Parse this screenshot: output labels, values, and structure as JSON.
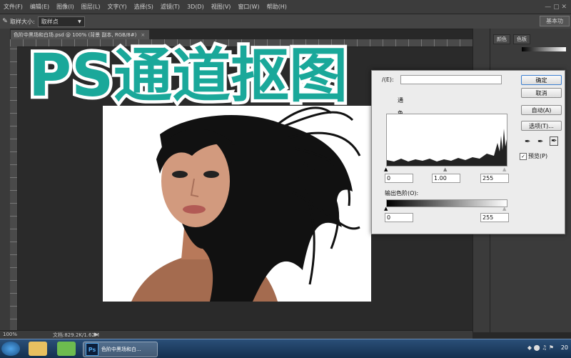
{
  "menu": [
    "文件(F)",
    "编辑(E)",
    "图像(I)",
    "图层(L)",
    "文字(Y)",
    "选择(S)",
    "滤镜(T)",
    "3D(D)",
    "视图(V)",
    "窗口(W)",
    "帮助(H)"
  ],
  "options": {
    "sample_size_label": "取样大小:",
    "sample_size_value": "取样点",
    "workspace": "基本功"
  },
  "document_tab": {
    "title": "色阶中黑场和白场.psd @ 100% (背景 副本, RGB/8#)",
    "close": "×"
  },
  "overlay_title": "PS通道抠图",
  "right_panel": {
    "tab1": "颜色",
    "tab2": "色板"
  },
  "levels_dialog": {
    "channel_label": "/(E):",
    "partial_label_1": "通",
    "partial_label_2": "色",
    "input_black": "0",
    "input_gamma": "1.00",
    "input_white": "255",
    "output_label": "输出色阶(O):",
    "output_black": "0",
    "output_white": "255",
    "buttons": {
      "ok": "确定",
      "cancel": "取消",
      "auto": "自动(A)",
      "options": "选项(T)..."
    },
    "preview_label": "预览(P)",
    "preview_checked": true
  },
  "status": {
    "zoom": "100%",
    "doc_info": "文档:829.2K/1.62M"
  },
  "taskbar": {
    "ps_item": "色阶中黑场和白...",
    "clock_partial": "20"
  },
  "colors": {
    "title_fill": "#1aa89a",
    "title_stroke": "#ffffff",
    "ui_dark": "#282828",
    "taskbar": "#1c3d63"
  }
}
